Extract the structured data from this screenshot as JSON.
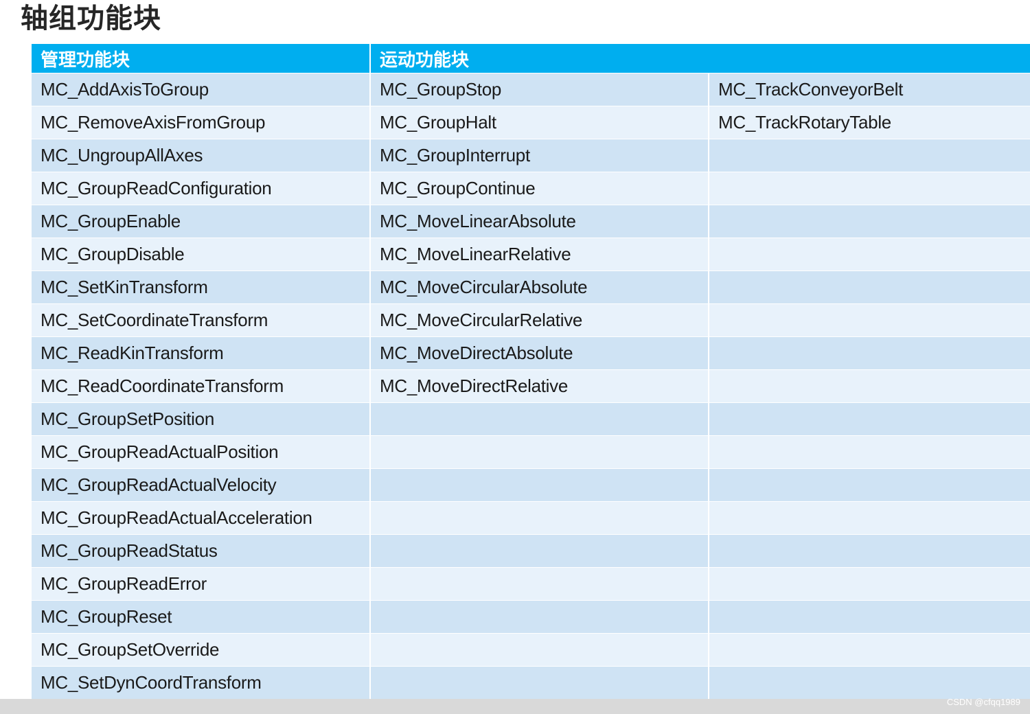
{
  "title": "轴组功能块",
  "headers": {
    "management": "管理功能块",
    "motion": "运动功能块"
  },
  "rows": [
    [
      "MC_AddAxisToGroup",
      "MC_GroupStop",
      "MC_TrackConveyorBelt"
    ],
    [
      "MC_RemoveAxisFromGroup",
      "MC_GroupHalt",
      "MC_TrackRotaryTable"
    ],
    [
      "MC_UngroupAllAxes",
      "MC_GroupInterrupt",
      ""
    ],
    [
      "MC_GroupReadConfiguration",
      "MC_GroupContinue",
      ""
    ],
    [
      "MC_GroupEnable",
      "MC_MoveLinearAbsolute",
      ""
    ],
    [
      "MC_GroupDisable",
      "MC_MoveLinearRelative",
      ""
    ],
    [
      "MC_SetKinTransform",
      "MC_MoveCircularAbsolute",
      ""
    ],
    [
      "MC_SetCoordinateTransform",
      "MC_MoveCircularRelative",
      ""
    ],
    [
      "MC_ReadKinTransform",
      "MC_MoveDirectAbsolute",
      ""
    ],
    [
      "MC_ReadCoordinateTransform",
      "MC_MoveDirectRelative",
      ""
    ],
    [
      "MC_GroupSetPosition",
      "",
      ""
    ],
    [
      "MC_GroupReadActualPosition",
      "",
      ""
    ],
    [
      "MC_GroupReadActualVelocity",
      "",
      ""
    ],
    [
      "MC_GroupReadActualAcceleration",
      "",
      ""
    ],
    [
      "MC_GroupReadStatus",
      "",
      ""
    ],
    [
      "MC_GroupReadError",
      "",
      ""
    ],
    [
      "MC_GroupReset",
      "",
      ""
    ],
    [
      "MC_GroupSetOverride",
      "",
      ""
    ],
    [
      "MC_SetDynCoordTransform",
      "",
      ""
    ]
  ],
  "credit": "CSDN @cfqq1989"
}
